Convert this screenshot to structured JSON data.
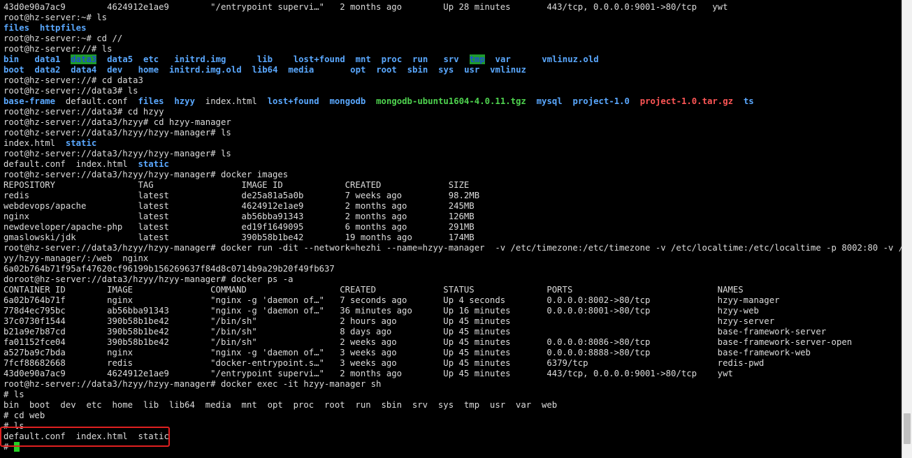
{
  "terminal": {
    "lines": [
      [
        {
          "t": "43d0e90a7ac9        4624912e1ae9        \"/entrypoint supervi…\"   2 months ago        Up 28 minutes       443/tcp, 0.0.0.0:9001->80/tcp   ywt"
        }
      ],
      [
        {
          "t": "root@hz-server:~# ls"
        }
      ],
      [
        {
          "t": "files",
          "c": "blue"
        },
        {
          "t": "  "
        },
        {
          "t": "httpfiles",
          "c": "blue"
        }
      ],
      [
        {
          "t": "root@hz-server:~# cd //"
        }
      ],
      [
        {
          "t": "root@hz-server://# ls"
        }
      ],
      [
        {
          "t": "bin",
          "c": "blue"
        },
        {
          "t": "   "
        },
        {
          "t": "data1",
          "c": "blue"
        },
        {
          "t": "  "
        },
        {
          "t": "data3",
          "c": "hl"
        },
        {
          "t": "  "
        },
        {
          "t": "data5",
          "c": "blue"
        },
        {
          "t": "  "
        },
        {
          "t": "etc",
          "c": "blue"
        },
        {
          "t": "   "
        },
        {
          "t": "initrd.img",
          "c": "blue"
        },
        {
          "t": "      "
        },
        {
          "t": "lib",
          "c": "blue"
        },
        {
          "t": "    "
        },
        {
          "t": "lost+found",
          "c": "blue"
        },
        {
          "t": "  "
        },
        {
          "t": "mnt",
          "c": "blue"
        },
        {
          "t": "  "
        },
        {
          "t": "proc",
          "c": "blue"
        },
        {
          "t": "  "
        },
        {
          "t": "run",
          "c": "blue"
        },
        {
          "t": "   "
        },
        {
          "t": "srv",
          "c": "blue"
        },
        {
          "t": "  "
        },
        {
          "t": "tmp",
          "c": "hl"
        },
        {
          "t": "  "
        },
        {
          "t": "var",
          "c": "blue"
        },
        {
          "t": "      "
        },
        {
          "t": "vmlinuz.old",
          "c": "blue"
        }
      ],
      [
        {
          "t": "boot",
          "c": "blue"
        },
        {
          "t": "  "
        },
        {
          "t": "data2",
          "c": "blue"
        },
        {
          "t": "  "
        },
        {
          "t": "data4",
          "c": "blue"
        },
        {
          "t": "  "
        },
        {
          "t": "dev",
          "c": "blue"
        },
        {
          "t": "   "
        },
        {
          "t": "home",
          "c": "blue"
        },
        {
          "t": "  "
        },
        {
          "t": "initrd.img.old",
          "c": "blue"
        },
        {
          "t": "  "
        },
        {
          "t": "lib64",
          "c": "blue"
        },
        {
          "t": "  "
        },
        {
          "t": "media",
          "c": "blue"
        },
        {
          "t": "       "
        },
        {
          "t": "opt",
          "c": "blue"
        },
        {
          "t": "  "
        },
        {
          "t": "root",
          "c": "blue"
        },
        {
          "t": "  "
        },
        {
          "t": "sbin",
          "c": "blue"
        },
        {
          "t": "  "
        },
        {
          "t": "sys",
          "c": "blue"
        },
        {
          "t": "  "
        },
        {
          "t": "usr",
          "c": "blue"
        },
        {
          "t": "  "
        },
        {
          "t": "vmlinuz",
          "c": "blue"
        }
      ],
      [
        {
          "t": "root@hz-server://# cd data3"
        }
      ],
      [
        {
          "t": "root@hz-server://data3# ls"
        }
      ],
      [
        {
          "t": "base-frame",
          "c": "blue"
        },
        {
          "t": "  default.conf  "
        },
        {
          "t": "files",
          "c": "blue"
        },
        {
          "t": "  "
        },
        {
          "t": "hzyy",
          "c": "blue"
        },
        {
          "t": "  index.html  "
        },
        {
          "t": "lost+found",
          "c": "blue"
        },
        {
          "t": "  "
        },
        {
          "t": "mongodb",
          "c": "blue"
        },
        {
          "t": "  "
        },
        {
          "t": "mongodb-ubuntu1604-4.0.11.tgz",
          "c": "green"
        },
        {
          "t": "  "
        },
        {
          "t": "mysql",
          "c": "blue"
        },
        {
          "t": "  "
        },
        {
          "t": "project-1.0",
          "c": "blue"
        },
        {
          "t": "  "
        },
        {
          "t": "project-1.0.tar.gz",
          "c": "red"
        },
        {
          "t": "  "
        },
        {
          "t": "ts",
          "c": "blue"
        }
      ],
      [
        {
          "t": "root@hz-server://data3# cd hzyy"
        }
      ],
      [
        {
          "t": "root@hz-server://data3/hzyy# cd hzyy-manager"
        }
      ],
      [
        {
          "t": "root@hz-server://data3/hzyy/hzyy-manager# ls"
        }
      ],
      [
        {
          "t": "index.html  "
        },
        {
          "t": "static",
          "c": "blue"
        }
      ],
      [
        {
          "t": "root@hz-server://data3/hzyy/hzyy-manager# ls"
        }
      ],
      [
        {
          "t": "default.conf  index.html  "
        },
        {
          "t": "static",
          "c": "blue"
        }
      ],
      [
        {
          "t": "root@hz-server://data3/hzyy/hzyy-manager# docker images"
        }
      ],
      [
        {
          "t": "REPOSITORY                TAG                 IMAGE ID            CREATED             SIZE"
        }
      ],
      [
        {
          "t": "redis                     latest              de25a81a5a0b        7 weeks ago         98.2MB"
        }
      ],
      [
        {
          "t": "webdevops/apache          latest              4624912e1ae9        2 months ago        245MB"
        }
      ],
      [
        {
          "t": "nginx                     latest              ab56bba91343        2 months ago        126MB"
        }
      ],
      [
        {
          "t": "newdeveloper/apache-php   latest              ed19f1649095        6 months ago        291MB"
        }
      ],
      [
        {
          "t": "gmaslowski/jdk            latest              390b58b1be42        19 months ago       174MB"
        }
      ],
      [
        {
          "t": "root@hz-server://data3/hzyy/hzyy-manager# docker run -dit --network=hezhi --name=hzyy-manager  -v /etc/timezone:/etc/timezone -v /etc/localtime:/etc/localtime -p 8002:80 -v /data3/hz"
        }
      ],
      [
        {
          "t": "yy/hzyy-manager/:/web  nginx"
        }
      ],
      [
        {
          "t": "6a02b764b71f95af47620cf96199b156269637f84d8c0714b9a29b20f49fb637"
        }
      ],
      [
        {
          "t": "doroot@hz-server://data3/hzyy/hzyy-manager# docker ps -a"
        }
      ],
      [
        {
          "t": "CONTAINER ID        IMAGE               COMMAND                  CREATED             STATUS              PORTS                            NAMES"
        }
      ],
      [
        {
          "t": "6a02b764b71f        nginx               \"nginx -g 'daemon of…\"   7 seconds ago       Up 4 seconds        0.0.0.0:8002->80/tcp             hzyy-manager"
        }
      ],
      [
        {
          "t": "778d4ec795bc        ab56bba91343        \"nginx -g 'daemon of…\"   36 minutes ago      Up 16 minutes       0.0.0.0:8001->80/tcp             hzyy-web"
        }
      ],
      [
        {
          "t": "37c0730f1544        390b58b1be42        \"/bin/sh\"                2 hours ago         Up 45 minutes                                        hzyy-server"
        }
      ],
      [
        {
          "t": "b21a9e7b87cd        390b58b1be42        \"/bin/sh\"                8 days ago          Up 45 minutes                                        base-framework-server"
        }
      ],
      [
        {
          "t": "fa01152fce04        390b58b1be42        \"/bin/sh\"                2 weeks ago         Up 45 minutes       0.0.0.0:8086->80/tcp             base-framework-server-open"
        }
      ],
      [
        {
          "t": "a527ba9c7bda        nginx               \"nginx -g 'daemon of…\"   3 weeks ago         Up 45 minutes       0.0.0.0:8888->80/tcp             base-framework-web"
        }
      ],
      [
        {
          "t": "7fcf88682668        redis               \"docker-entrypoint.s…\"   3 weeks ago         Up 45 minutes       6379/tcp                         redis-pwd"
        }
      ],
      [
        {
          "t": "43d0e90a7ac9        4624912e1ae9        \"/entrypoint supervi…\"   2 months ago        Up 45 minutes       443/tcp, 0.0.0.0:9001->80/tcp    ywt"
        }
      ],
      [
        {
          "t": "root@hz-server://data3/hzyy/hzyy-manager# docker exec -it hzyy-manager sh"
        }
      ],
      [
        {
          "t": "# ls"
        }
      ],
      [
        {
          "t": "bin  boot  dev  etc  home  lib  lib64  media  mnt  opt  proc  root  run  sbin  srv  sys  tmp  usr  var  web"
        }
      ],
      [
        {
          "t": "# cd web"
        }
      ],
      [
        {
          "t": "# ls"
        }
      ],
      [
        {
          "t": "default.conf  index.html  static"
        }
      ],
      [
        {
          "t": "# "
        }
      ]
    ]
  },
  "colors": {
    "text": "#dcdcdc",
    "directory": "#5aa8ff",
    "archive": "#ff5656",
    "executable": "#4fd34f",
    "highlight_bg": "#1e9a2e",
    "annotation": "#e02020"
  }
}
